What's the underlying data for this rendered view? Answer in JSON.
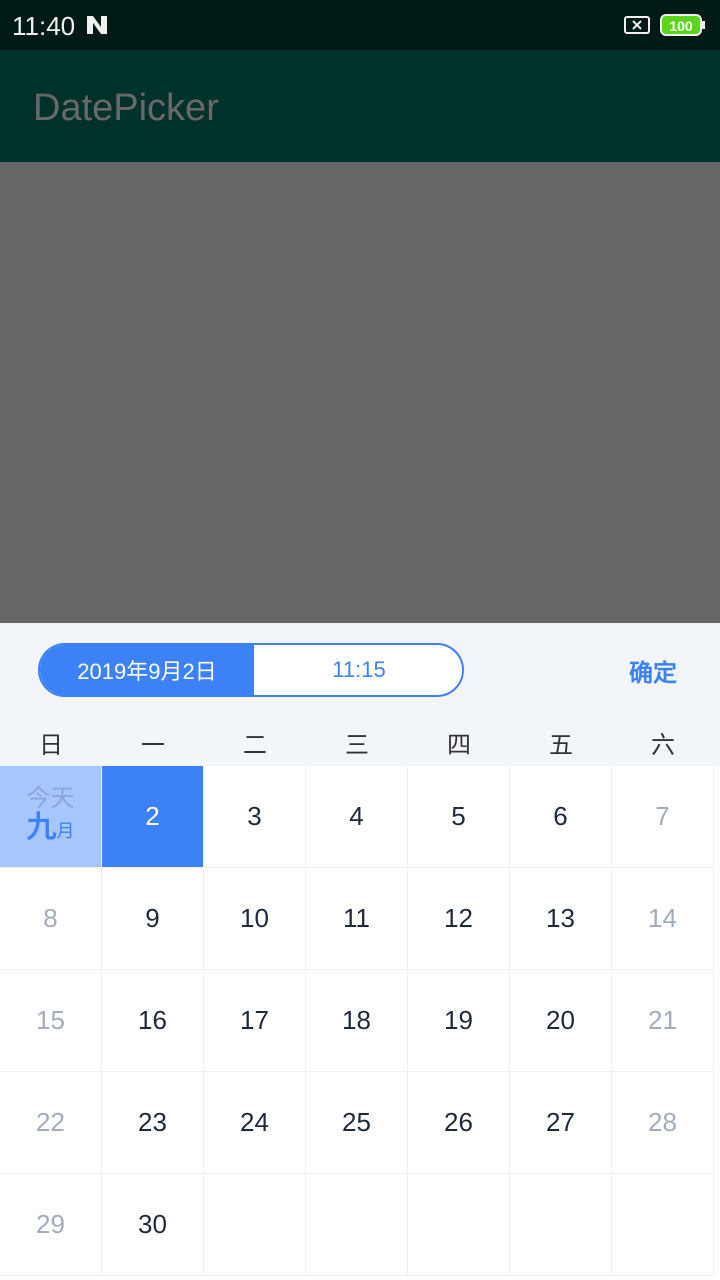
{
  "status_bar": {
    "time": "11:40",
    "battery_level": "100"
  },
  "app_bar": {
    "title": "DatePicker"
  },
  "picker": {
    "date_tab": "2019年9月2日",
    "time_tab": "11:15",
    "confirm_label": "确定",
    "weekdays": [
      "日",
      "一",
      "二",
      "三",
      "四",
      "五",
      "六"
    ],
    "today_label": "今天",
    "month_label": "九",
    "month_suffix": "月",
    "selected_day": "2",
    "days": [
      [
        "",
        "2",
        "3",
        "4",
        "5",
        "6",
        "7"
      ],
      [
        "8",
        "9",
        "10",
        "11",
        "12",
        "13",
        "14"
      ],
      [
        "15",
        "16",
        "17",
        "18",
        "19",
        "20",
        "21"
      ],
      [
        "22",
        "23",
        "24",
        "25",
        "26",
        "27",
        "28"
      ],
      [
        "29",
        "30",
        "",
        "",
        "",
        "",
        ""
      ]
    ]
  },
  "colors": {
    "accent": "#3c82f6",
    "app_bar": "#00322b",
    "status_bar": "#001a16",
    "weekend_text": "#a3acbd",
    "today_bg": "#a7c6fd"
  }
}
